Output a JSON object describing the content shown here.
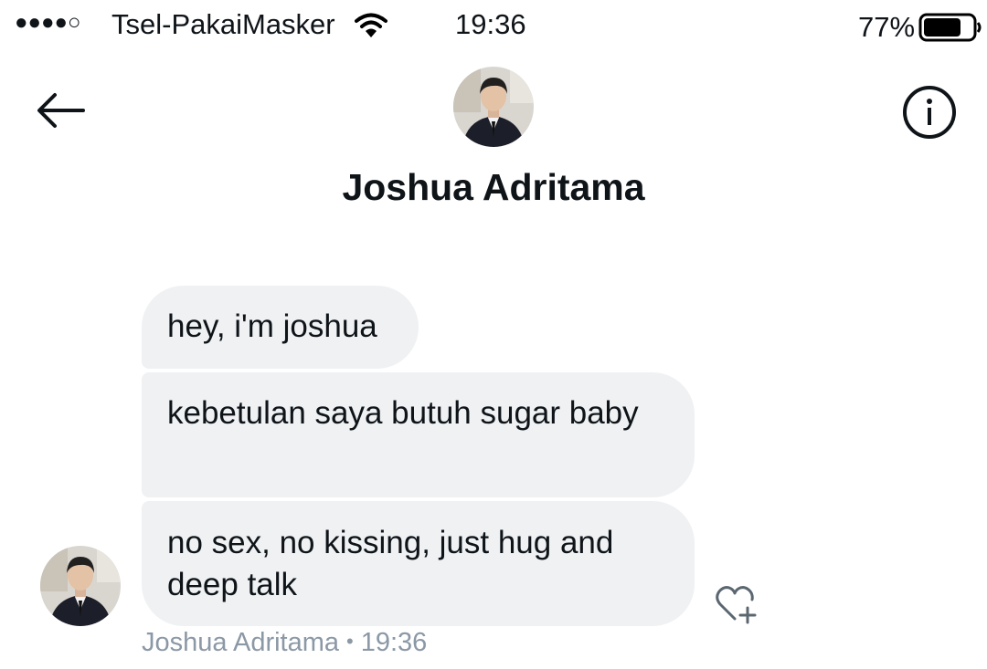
{
  "status_bar": {
    "signal": "●●●●○",
    "carrier": "Tsel-PakaiMasker",
    "time": "19:36",
    "battery_percent": "77%",
    "battery_level": 0.77,
    "icons": [
      "wifi-icon",
      "battery-icon"
    ]
  },
  "header": {
    "contact_name": "Joshua Adritama",
    "icons": [
      "back-arrow-icon",
      "info-icon"
    ]
  },
  "messages": [
    {
      "text": "hey, i'm joshua"
    },
    {
      "text": "kebetulan saya butuh sugar baby"
    },
    {
      "text": "no sex, no kissing, just hug and deep talk"
    }
  ],
  "meta": {
    "sender": "Joshua Adritama",
    "separator": "•",
    "time": "19:36"
  },
  "actions": {
    "react_icon": "heart-add-icon"
  },
  "colors": {
    "bubble_bg": "#eff1f3",
    "text": "#0f1419",
    "meta_text": "#8b98a5"
  }
}
